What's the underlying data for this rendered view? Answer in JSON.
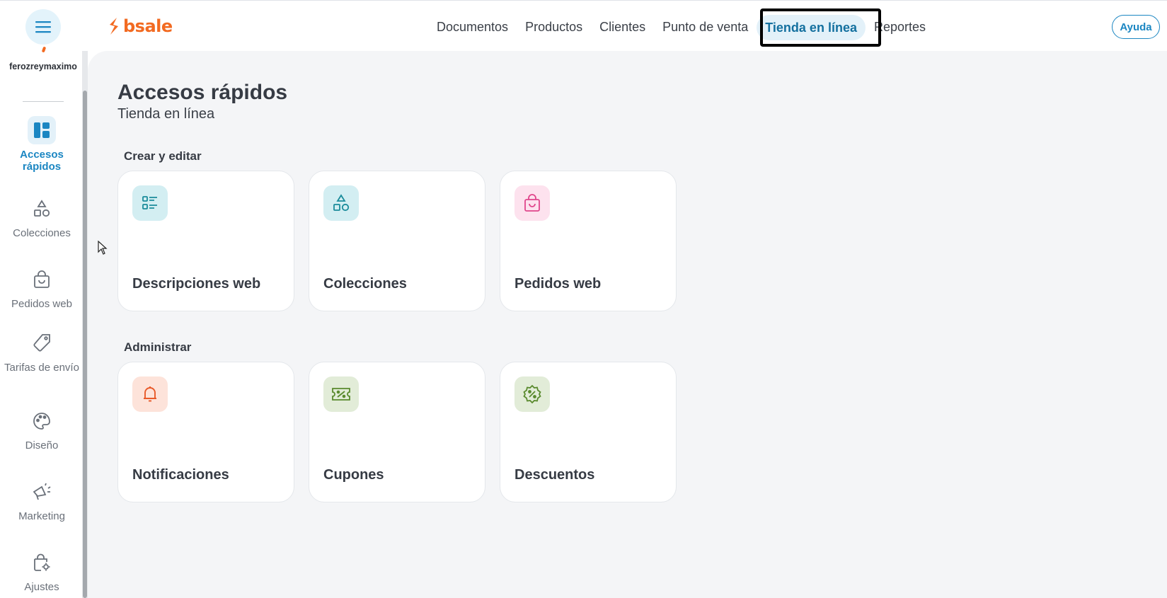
{
  "app": {
    "logo_text": "bsale",
    "brand_color": "#f26a21",
    "accent_color": "#1b86c2"
  },
  "header": {
    "menu_icon": "hamburger-icon",
    "nav": [
      "Documentos",
      "Productos",
      "Clientes",
      "Punto de venta",
      "Tienda en línea",
      "Reportes"
    ],
    "active_nav": "Tienda en línea",
    "help_label": "Ayuda"
  },
  "sidebar": {
    "username": "ferozreymaximo",
    "items": [
      {
        "label": "Accesos rápidos",
        "icon": "dashboard-icon",
        "active": true
      },
      {
        "label": "Colecciones",
        "icon": "shapes-icon"
      },
      {
        "label": "Pedidos web",
        "icon": "shopping-bag-icon"
      },
      {
        "label": "Tarifas de envío",
        "icon": "tag-icon"
      },
      {
        "label": "Diseño",
        "icon": "palette-icon"
      },
      {
        "label": "Marketing",
        "icon": "megaphone-icon"
      },
      {
        "label": "Ajustes",
        "icon": "bag-settings-icon"
      }
    ]
  },
  "main": {
    "title": "Accesos rápidos",
    "subtitle": "Tienda en línea",
    "sections": [
      {
        "label": "Crear y editar",
        "cards": [
          {
            "label": "Descripciones web",
            "icon": "list-icon",
            "bg": "#d3eef2",
            "fg": "#1b8c9b"
          },
          {
            "label": "Colecciones",
            "icon": "shapes-icon",
            "bg": "#d3eef2",
            "fg": "#1b8c9b"
          },
          {
            "label": "Pedidos web",
            "icon": "shopping-bag-icon",
            "bg": "#fde2ee",
            "fg": "#e0468c"
          }
        ]
      },
      {
        "label": "Administrar",
        "cards": [
          {
            "label": "Notificaciones",
            "icon": "bell-icon",
            "bg": "#fde3da",
            "fg": "#e85a2a"
          },
          {
            "label": "Cupones",
            "icon": "ticket-icon",
            "bg": "#e2ecd8",
            "fg": "#5a8a2e"
          },
          {
            "label": "Descuentos",
            "icon": "discount-badge-icon",
            "bg": "#e2ecd8",
            "fg": "#5a8a2e"
          }
        ]
      }
    ]
  }
}
